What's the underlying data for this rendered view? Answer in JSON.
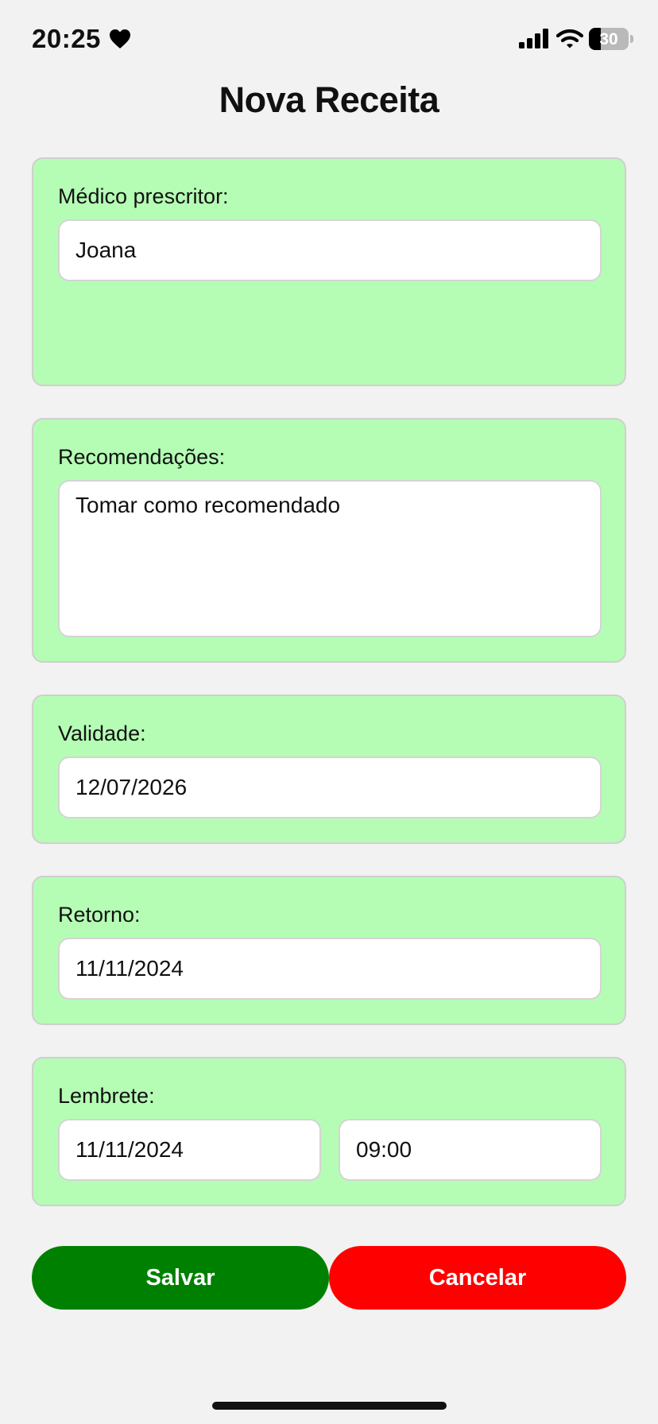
{
  "status_bar": {
    "time": "20:25",
    "battery_percent": "30",
    "battery_level": 0.3,
    "icons": [
      "heart-icon",
      "cellular-signal-icon",
      "wifi-icon",
      "battery-icon"
    ]
  },
  "page": {
    "title": "Nova Receita"
  },
  "form": {
    "doctor": {
      "label": "Médico prescritor:",
      "value": "Joana"
    },
    "recommendations": {
      "label": "Recomendações:",
      "value": "Tomar como recomendado"
    },
    "validity": {
      "label": "Validade:",
      "value": "12/07/2026"
    },
    "return": {
      "label": "Retorno:",
      "value": "11/11/2024"
    },
    "reminder": {
      "label": "Lembrete:",
      "date": "11/11/2024",
      "time": "09:00"
    }
  },
  "actions": {
    "save_label": "Salvar",
    "cancel_label": "Cancelar"
  },
  "colors": {
    "background": "#f2f2f2",
    "card": "#b5fdb5",
    "save": "#008000",
    "cancel": "#ff0000"
  }
}
